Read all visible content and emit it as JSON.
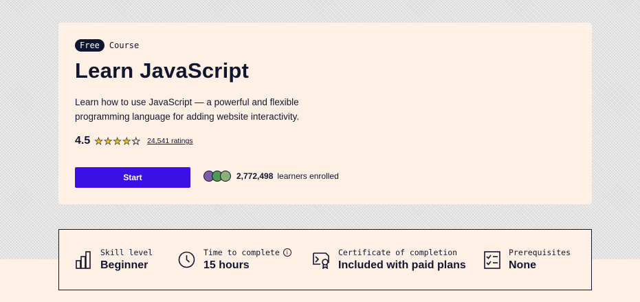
{
  "course": {
    "badge": "Free",
    "type_label": "Course",
    "title": "Learn JavaScript",
    "description": "Learn how to use JavaScript — a powerful and flexible programming language for adding website interactivity.",
    "rating": {
      "value": "4.5",
      "stars_filled": 4,
      "stars_total": 5,
      "count_label": "24,541 ratings"
    },
    "start_label": "Start",
    "enrolled": {
      "count": "2,772,498",
      "suffix": "learners enrolled"
    }
  },
  "info": {
    "skill": {
      "label": "Skill level",
      "value": "Beginner",
      "icon": "bar-chart-icon"
    },
    "time": {
      "label": "Time to complete",
      "value": "15 hours",
      "icon": "clock-icon",
      "help_icon": "info-icon"
    },
    "certificate": {
      "label": "Certificate of completion",
      "value": "Included with paid plans",
      "icon": "certificate-icon"
    },
    "prereq": {
      "label": "Prerequisites",
      "value": "None",
      "icon": "checklist-icon"
    }
  },
  "colors": {
    "accent": "#3a10e5",
    "dark": "#10162f",
    "background": "#fff0e5",
    "star": "#f5c518"
  }
}
